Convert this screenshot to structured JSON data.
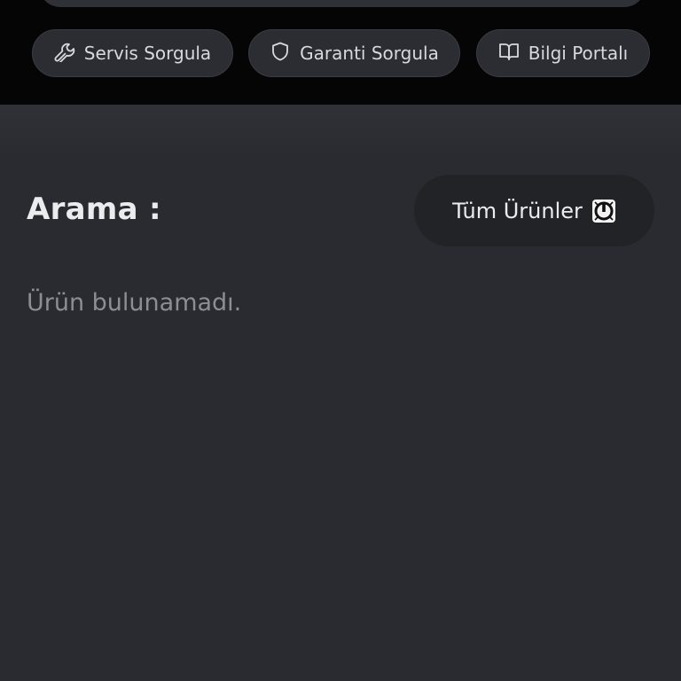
{
  "quick_links": [
    {
      "label": "Servis Sorgula",
      "icon": "wrench-icon"
    },
    {
      "label": "Garanti Sorgula",
      "icon": "shield-icon"
    },
    {
      "label": "Bilgi Portalı",
      "icon": "book-open-icon"
    }
  ],
  "search": {
    "heading": "Arama :",
    "filter_button_label": "Tüm Ürünler",
    "filter_button_icon": "power-icon",
    "empty_message": "Ürün bulunamadı."
  },
  "colors": {
    "top_background": "#050506",
    "page_background": "#2a2b30",
    "pill_background": "#2b2d33",
    "filter_background": "#222327"
  }
}
